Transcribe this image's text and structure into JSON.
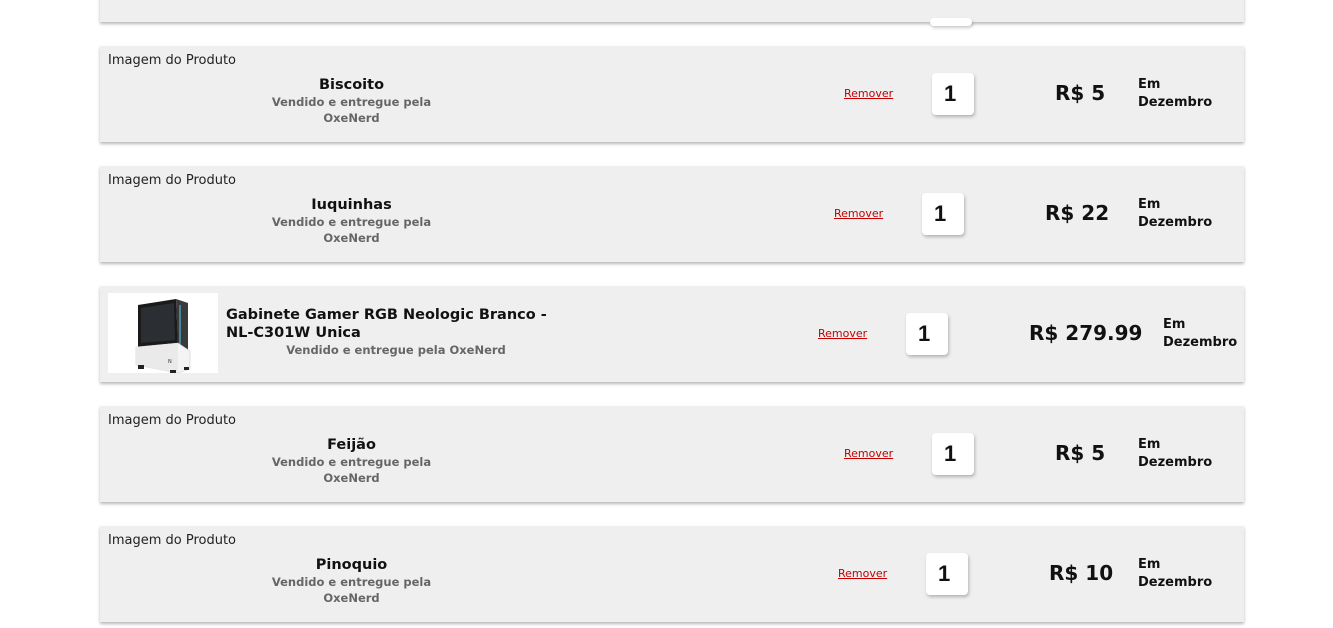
{
  "cart": {
    "items": [
      {
        "image_alt": "Imagem do Produto",
        "name": "Biscoito",
        "seller": "Vendido e entregue pela OxeNerd",
        "remove_label": "Remover",
        "quantity": "1",
        "price": "R$ 5",
        "delivery": "Em Dezembro"
      },
      {
        "image_alt": "Imagem do Produto",
        "name": "Iuquinhas",
        "seller": "Vendido e entregue pela OxeNerd",
        "remove_label": "Remover",
        "quantity": "1",
        "price": "R$ 22",
        "delivery": "Em Dezembro"
      },
      {
        "image_alt": "",
        "name": "Gabinete Gamer RGB Neologic Branco - NL-C301W Unica",
        "seller": "Vendido e entregue pela OxeNerd",
        "remove_label": "Remover",
        "quantity": "1",
        "price": "R$ 279.99",
        "delivery": "Em Dezembro"
      },
      {
        "image_alt": "Imagem do Produto",
        "name": "Feijão",
        "seller": "Vendido e entregue pela OxeNerd",
        "remove_label": "Remover",
        "quantity": "1",
        "price": "R$ 5",
        "delivery": "Em Dezembro"
      },
      {
        "image_alt": "Imagem do Produto",
        "name": "Pinoquio",
        "seller": "Vendido e entregue pela OxeNerd",
        "remove_label": "Remover",
        "quantity": "1",
        "price": "R$ 10",
        "delivery": "Em Dezembro"
      }
    ]
  }
}
